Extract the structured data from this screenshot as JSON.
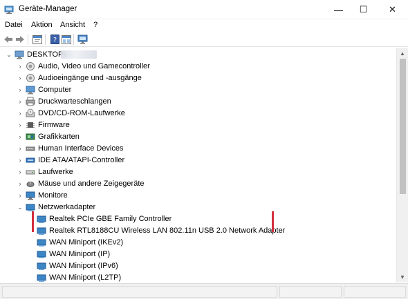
{
  "window": {
    "title": "Geräte-Manager",
    "controls": {
      "minimize": "—",
      "maximize": "☐",
      "close": "✕"
    }
  },
  "menu": [
    "Datei",
    "Aktion",
    "Ansicht",
    "?"
  ],
  "toolbar": {
    "buttons": [
      "back-arrow-icon",
      "forward-arrow-icon",
      "properties-icon",
      "help-icon",
      "show-hidden-icon",
      "scan-monitor-icon"
    ]
  },
  "tree": {
    "root": {
      "label": "DESKTOP-",
      "expanded": true
    },
    "categories": [
      {
        "label": "Audio, Video und Gamecontroller",
        "icon": "speaker-icon"
      },
      {
        "label": "Audioeingänge und -ausgänge",
        "icon": "speaker-icon"
      },
      {
        "label": "Computer",
        "icon": "computer-icon"
      },
      {
        "label": "Druckwarteschlangen",
        "icon": "printer-icon"
      },
      {
        "label": "DVD/CD-ROM-Laufwerke",
        "icon": "disc-icon"
      },
      {
        "label": "Firmware",
        "icon": "chip-icon"
      },
      {
        "label": "Grafikkarten",
        "icon": "display-adapter-icon"
      },
      {
        "label": "Human Interface Devices",
        "icon": "hid-icon"
      },
      {
        "label": "IDE ATA/ATAPI-Controller",
        "icon": "ide-controller-icon"
      },
      {
        "label": "Laufwerke",
        "icon": "drive-icon"
      },
      {
        "label": "Mäuse und andere Zeigegeräte",
        "icon": "mouse-icon"
      },
      {
        "label": "Monitore",
        "icon": "monitor-icon"
      },
      {
        "label": "Netzwerkadapter",
        "icon": "network-adapter-icon",
        "expanded": true
      }
    ],
    "network_adapters": [
      {
        "label": "Realtek PCIe GBE Family Controller"
      },
      {
        "label": "Realtek RTL8188CU Wireless LAN 802.11n USB 2.0 Network Adapter"
      },
      {
        "label": "WAN Miniport (IKEv2)"
      },
      {
        "label": "WAN Miniport (IP)"
      },
      {
        "label": "WAN Miniport (IPv6)"
      },
      {
        "label": "WAN Miniport (L2TP)"
      }
    ]
  },
  "colors": {
    "highlight_marker": "#d32f3f",
    "adapter_icon": "#3d86c6"
  }
}
